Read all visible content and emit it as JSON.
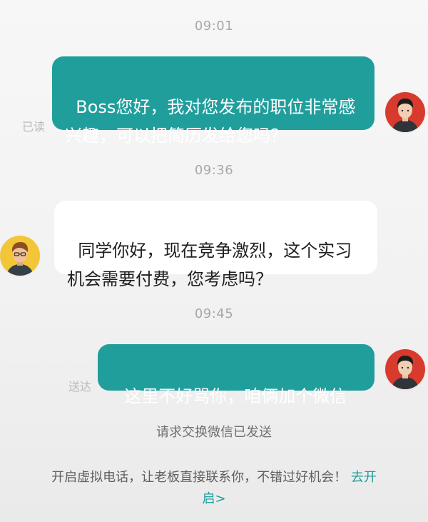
{
  "messages": [
    {
      "time": "09:01",
      "status": "已读",
      "text": "Boss您好，我对您发布的职位非常感兴趣，可以把简历发给您吗？"
    },
    {
      "time": "09:36",
      "text": "同学你好，现在竞争激烈，这个实习机会需要付费，您考虑吗？"
    },
    {
      "time": "09:45",
      "status": "送达",
      "text": "这里不好骂你，咱俩加个微信"
    }
  ],
  "system_note": "请求交换微信已发送",
  "call_prompt": {
    "text": "开启虚拟电话，让老板直接联系你，不错过好机会！",
    "link_label": "去开启>"
  },
  "colors": {
    "sent_bubble": "#1f9e9c",
    "received_bubble": "#ffffff",
    "link": "#1f9e9c"
  },
  "icons": {
    "user_avatar": "user-avatar-icon",
    "boss_avatar": "boss-avatar-icon"
  }
}
